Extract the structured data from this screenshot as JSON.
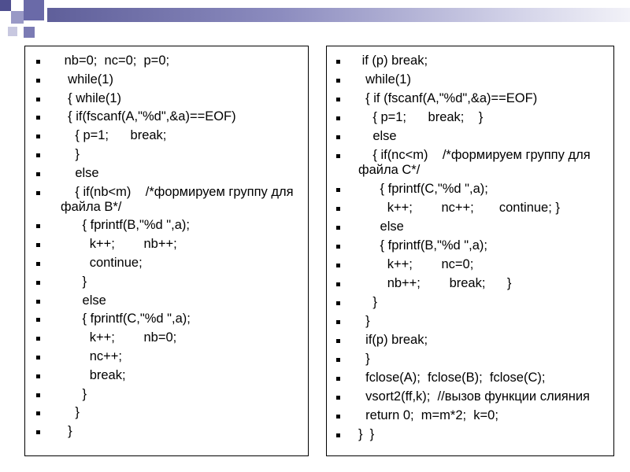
{
  "slide": {
    "left_column": [
      " nb=0;  nc=0;  p=0;",
      "  while(1)",
      "  { while(1)",
      "  { if(fscanf(A,\"%d\",&a)==EOF)",
      "    { p=1;      break;",
      "    }",
      "    else",
      "    { if(nb<m)    /*формируем группу для файла B*/",
      "      { fprintf(B,\"%d \",a);",
      "        k++;        nb++;",
      "        continue;",
      "      }",
      "      else",
      "      { fprintf(C,\"%d \",a);",
      "        k++;        nb=0;",
      "        nc++;",
      "        break;",
      "      }",
      "    }",
      "  }"
    ],
    "right_column": [
      " if (p) break;",
      "  while(1)",
      "  { if (fscanf(A,\"%d\",&a)==EOF)",
      "    { p=1;      break;    }",
      "    else",
      "    { if(nc<m)    /*формируем группу для файла C*/",
      "      { fprintf(C,\"%d \",a);",
      "        k++;        nc++;       continue; }",
      "      else",
      "      { fprintf(B,\"%d \",a);",
      "        k++;        nc=0;",
      "        nb++;        break;      }",
      "    }",
      "  }",
      "  if(p) break;",
      "  }",
      "  fclose(A);  fclose(B);  fclose(C);",
      "  vsort2(ff,k);  //вызов функции слияния",
      "  return 0;  m=m*2;  k=0;",
      "}  }"
    ]
  }
}
